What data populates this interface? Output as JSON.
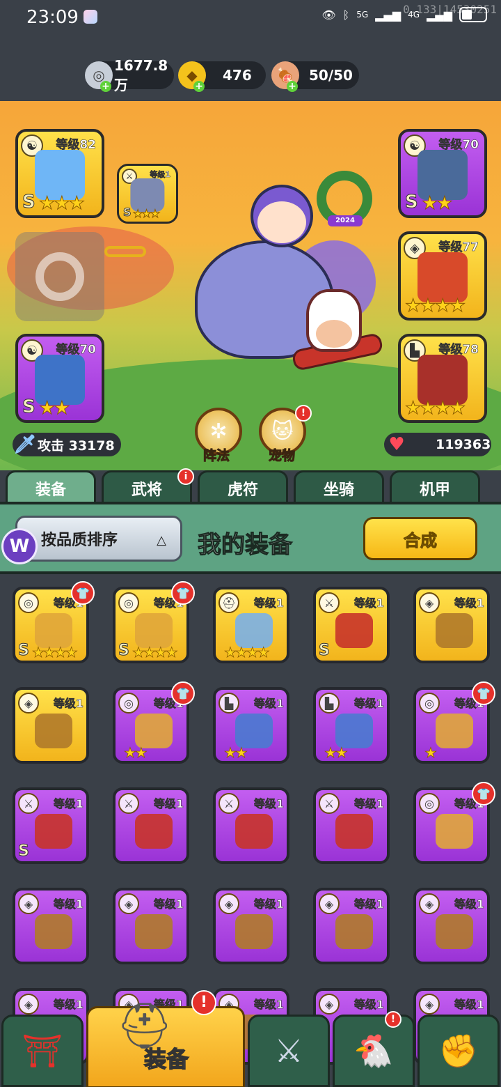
{
  "status_bar": {
    "time": "23:09",
    "network": "5G",
    "network2": "4G",
    "ip": "0.133|14530251"
  },
  "currency": {
    "silver": "1677.8万",
    "gold": "476",
    "stamina": "50/50"
  },
  "hero_slots": {
    "left_top": {
      "level": "等级82",
      "grade": "S",
      "stars": "★★★"
    },
    "left_small": {
      "level": "等级1",
      "grade": "S",
      "stars": "★★★"
    },
    "left_bottom": {
      "level": "等级70",
      "grade": "S",
      "stars": "★★"
    },
    "right_top": {
      "level": "等级70",
      "grade": "S",
      "stars": "★★"
    },
    "right_mid": {
      "level": "等级77",
      "stars": "★★★★"
    },
    "right_bottom": {
      "level": "等级78",
      "stars": "★★★★"
    }
  },
  "wreath_tag": "2024",
  "stats": {
    "attack_label": "攻击 33178",
    "hp_value": "119363"
  },
  "round_buttons": {
    "formation": "阵法",
    "pet": "宠物",
    "pet_notif": "!"
  },
  "tabs": [
    {
      "label": "装备",
      "active": true
    },
    {
      "label": "武将",
      "notif": "i"
    },
    {
      "label": "虎符"
    },
    {
      "label": "坐骑"
    },
    {
      "label": "机甲"
    }
  ],
  "equip_bar": {
    "sort_label": "按品质排序",
    "sort_indicator": "△",
    "logo": "W",
    "title": "我的装备",
    "combine_label": "合成"
  },
  "inventory": [
    {
      "level": "等级1",
      "quality": "gold",
      "type": "medal",
      "stars": "★★★★",
      "grade": "S",
      "new": true
    },
    {
      "level": "等级1",
      "quality": "gold",
      "type": "medal",
      "stars": "★★★★",
      "grade": "S",
      "new": true
    },
    {
      "level": "等级1",
      "quality": "gold",
      "type": "helmet",
      "stars": "★★★★"
    },
    {
      "level": "等级1",
      "quality": "gold",
      "type": "weapon",
      "grade": "S"
    },
    {
      "level": "等级1",
      "quality": "gold",
      "type": "armor"
    },
    {
      "level": "等级1",
      "quality": "gold",
      "type": "armor"
    },
    {
      "level": "等级1",
      "quality": "purple",
      "type": "medal",
      "stars": "★★",
      "new": true
    },
    {
      "level": "等级1",
      "quality": "purple",
      "type": "boots",
      "stars": "★★"
    },
    {
      "level": "等级1",
      "quality": "purple",
      "type": "boots",
      "stars": "★★"
    },
    {
      "level": "等级1",
      "quality": "purple",
      "type": "medal",
      "stars": "★",
      "new": true
    },
    {
      "level": "等级1",
      "quality": "purple",
      "type": "weapon",
      "grade": "S"
    },
    {
      "level": "等级1",
      "quality": "purple",
      "type": "weapon"
    },
    {
      "level": "等级1",
      "quality": "purple",
      "type": "weapon"
    },
    {
      "level": "等级1",
      "quality": "purple",
      "type": "weapon"
    },
    {
      "level": "等级1",
      "quality": "purple",
      "type": "medal",
      "new": true
    },
    {
      "level": "等级1",
      "quality": "purple",
      "type": "armor"
    },
    {
      "level": "等级1",
      "quality": "purple",
      "type": "armor"
    },
    {
      "level": "等级1",
      "quality": "purple",
      "type": "armor"
    },
    {
      "level": "等级1",
      "quality": "purple",
      "type": "armor"
    },
    {
      "level": "等级1",
      "quality": "purple",
      "type": "armor"
    },
    {
      "level": "等级1",
      "quality": "purple",
      "type": "armor"
    },
    {
      "level": "等级1",
      "quality": "purple",
      "type": "armor"
    },
    {
      "level": "等级1",
      "quality": "purple",
      "type": "armor"
    },
    {
      "level": "等级1",
      "quality": "purple",
      "type": "armor"
    },
    {
      "level": "等级1",
      "quality": "purple",
      "type": "armor"
    }
  ],
  "bottom_nav": {
    "active_label": "装备",
    "notif": "!"
  },
  "colors": {
    "gold_card": "#f2b41c",
    "purple_card": "#9a33d6",
    "tab_green": "#2e5a46",
    "badge_red": "#e5312b"
  }
}
